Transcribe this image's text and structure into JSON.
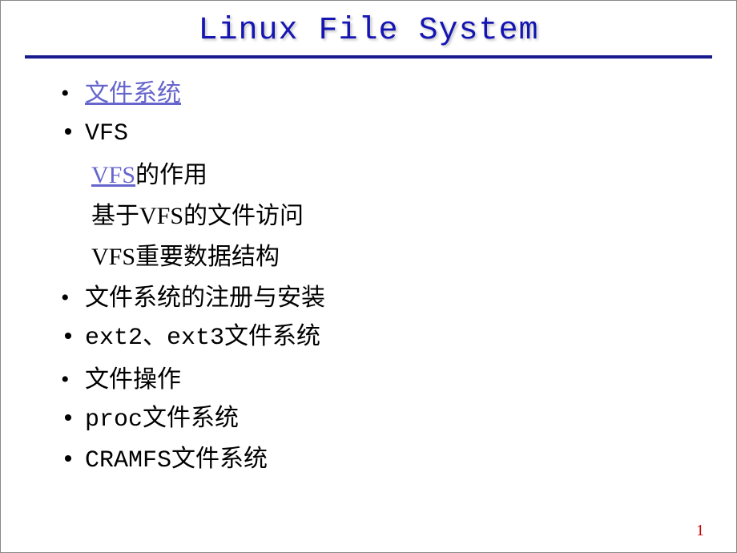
{
  "title": "Linux File System",
  "items": {
    "item1_link": "文件系统",
    "item2": "VFS",
    "sub1_link": "VFS",
    "sub1_rest": "的作用",
    "sub2": "基于VFS的文件访问",
    "sub3": "VFS重要数据结构",
    "item3": "文件系统的注册与安装",
    "item4": "ext2、ext3文件系统",
    "item5": "文件操作",
    "item6": "proc文件系统",
    "item7": "CRAMFS文件系统"
  },
  "page_number": "1"
}
